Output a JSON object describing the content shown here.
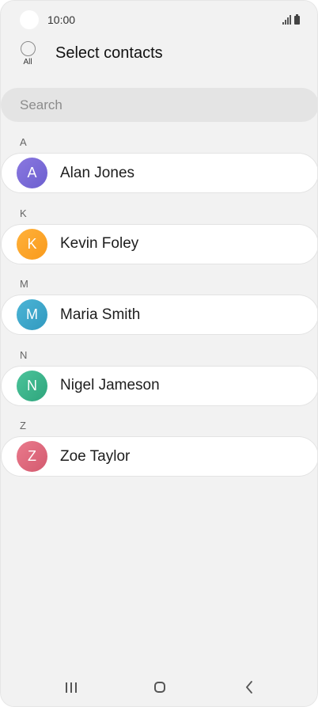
{
  "status_bar": {
    "time": "10:00",
    "signal_icon": "signal-bars-icon",
    "battery_icon": "battery-icon"
  },
  "header": {
    "select_all_label": "All",
    "title": "Select contacts"
  },
  "search": {
    "placeholder": "Search",
    "value": ""
  },
  "contacts": [
    {
      "section": "A",
      "initial": "A",
      "name": "Alan Jones",
      "color_start": "#8a78e0",
      "color_end": "#6c5fcf"
    },
    {
      "section": "K",
      "initial": "K",
      "name": "Kevin Foley",
      "color_start": "#ffb13a",
      "color_end": "#f99a1c"
    },
    {
      "section": "M",
      "initial": "M",
      "name": "Maria Smith",
      "color_start": "#4cb5d6",
      "color_end": "#3199bf"
    },
    {
      "section": "N",
      "initial": "N",
      "name": "Nigel Jameson",
      "color_start": "#4cc49b",
      "color_end": "#2ea57c"
    },
    {
      "section": "Z",
      "initial": "Z",
      "name": "Zoe Taylor",
      "color_start": "#ea7a8c",
      "color_end": "#d35a6f"
    }
  ],
  "nav_bar": {
    "recent_icon": "recent-apps-icon",
    "home_icon": "home-icon",
    "back_icon": "back-icon"
  }
}
